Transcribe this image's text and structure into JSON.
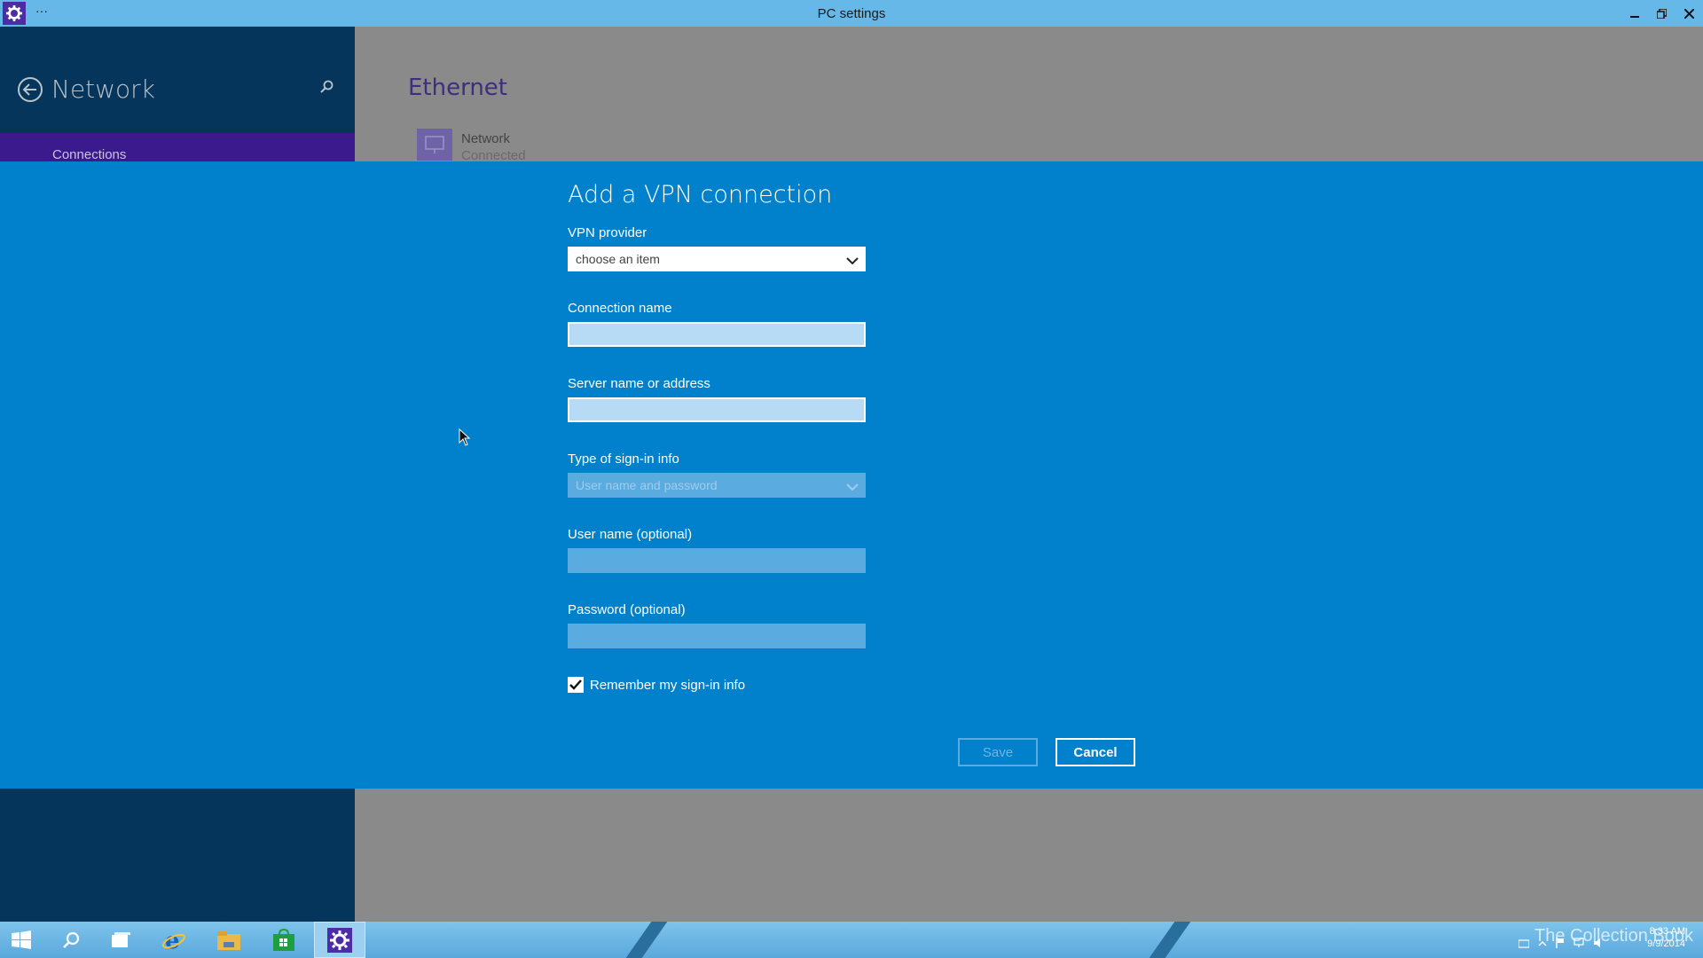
{
  "window": {
    "title": "PC settings",
    "menu": "···",
    "icon": "gear-icon"
  },
  "left": {
    "header": "Network",
    "items": [
      {
        "label": "Connections"
      }
    ]
  },
  "main": {
    "section_title": "Ethernet",
    "network": {
      "name": "Network",
      "status": "Connected",
      "icon": "network-icon"
    }
  },
  "dialog": {
    "title": "Add a VPN connection",
    "vpn_provider": {
      "label": "VPN provider",
      "value": "choose an item"
    },
    "connection_name": {
      "label": "Connection name",
      "value": ""
    },
    "server": {
      "label": "Server name or address",
      "value": ""
    },
    "signin_type": {
      "label": "Type of sign-in info",
      "value": "User name and password"
    },
    "username": {
      "label": "User name (optional)",
      "value": ""
    },
    "password": {
      "label": "Password (optional)",
      "value": ""
    },
    "remember": {
      "label": "Remember my sign-in info",
      "checked": true
    },
    "save_label": "Save",
    "cancel_label": "Cancel"
  },
  "taskbar": {
    "apps": [
      "start-icon",
      "search-icon",
      "task-view-icon",
      "internet-explorer-icon",
      "file-explorer-icon",
      "store-icon",
      "settings-icon"
    ],
    "clock_time": "8:33 AM",
    "clock_date": "9/9/2014",
    "watermark": "The Collection Book"
  },
  "colors": {
    "dialog_bg": "#0180cc",
    "left_pane": "#05355a",
    "accent": "#3a1a8c",
    "titlebar": "#66b8e8"
  }
}
